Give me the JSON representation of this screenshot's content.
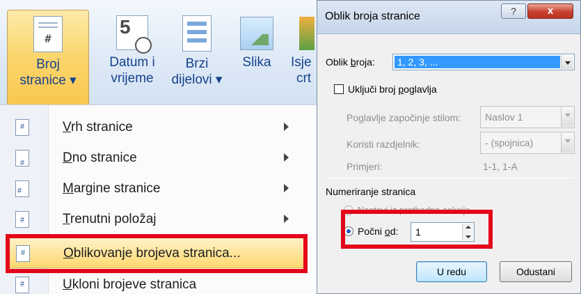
{
  "ribbon": {
    "buttons": [
      {
        "line1": "Broj",
        "line2": "stranice ▾",
        "icon": "page-number-icon",
        "active": true
      },
      {
        "line1": "Datum i",
        "line2": "vrijeme",
        "icon": "calendar-clock-icon"
      },
      {
        "line1": "Brzi",
        "line2": "dijelovi ▾",
        "icon": "quick-parts-icon"
      },
      {
        "line1": "Slika",
        "line2": "",
        "icon": "picture-icon"
      },
      {
        "line1": "Isje",
        "line2": "crt",
        "icon": "shapes-icon"
      }
    ]
  },
  "menu": {
    "items": [
      {
        "accel": "V",
        "rest": "rh stranice",
        "submenu": true,
        "icon": "header-page-icon"
      },
      {
        "accel": "D",
        "rest": "no stranice",
        "submenu": true,
        "icon": "footer-page-icon"
      },
      {
        "accel": "M",
        "rest": "argine stranice",
        "submenu": true,
        "icon": "margin-page-icon"
      },
      {
        "accel": "T",
        "rest": "renutni položaj",
        "submenu": true,
        "icon": "current-position-icon"
      },
      {
        "accel": "O",
        "rest": "blikovanje brojeva stranica...",
        "submenu": false,
        "highlighted": true,
        "icon": "format-page-numbers-icon"
      },
      {
        "accel": "U",
        "rest": "kloni brojeve stranica",
        "submenu": false,
        "icon": "remove-page-numbers-icon"
      }
    ]
  },
  "dialog": {
    "title": "Oblik broja stranice",
    "help_glyph": "?",
    "close_glyph": "x",
    "format_label_pre": "Oblik ",
    "format_label_accel": "b",
    "format_label_post": "roja:",
    "format_value": "1, 2, 3, ...",
    "include_chapter_pre": "Uključi broj ",
    "include_chapter_accel": "p",
    "include_chapter_post": "oglavlja",
    "include_chapter_checked": false,
    "chapter_style_label": "Poglavlje započinje stilom:",
    "chapter_style_value": "Naslov 1",
    "separator_label": "Koristi razdjelnik:",
    "separator_value": "-   (spojnica)",
    "examples_label": "Primjeri:",
    "examples_value": "1-1, 1-A",
    "numbering_section": "Numeriranje stranica",
    "continue_label": "Nastavi iz prethodne sekcije",
    "start_at_pre": "Počni ",
    "start_at_accel": "o",
    "start_at_post": "d:",
    "start_at_value": "1",
    "ok_label": "U redu",
    "cancel_label": "Odustani"
  },
  "colors": {
    "highlight_box": "#e3061a",
    "selection": "#3399ff",
    "ribbon_text": "#15428b"
  }
}
